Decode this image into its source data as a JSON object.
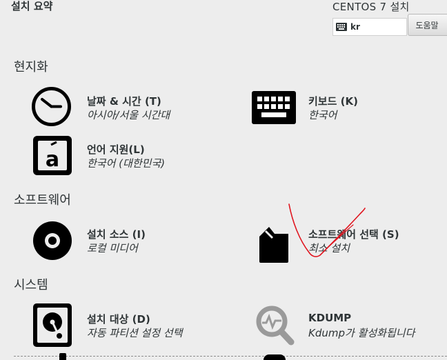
{
  "header": {
    "title": "설치 요약",
    "product": "CENTOS 7 설치",
    "keyboard_layout": "kr",
    "help_label": "도움말"
  },
  "sections": {
    "localization": "현지화",
    "software": "소프트웨어",
    "system": "시스템"
  },
  "spokes": {
    "datetime": {
      "title": "날짜 & 시간 (T)",
      "status": "아시아/서울 시간대"
    },
    "keyboard": {
      "title": "키보드 (K)",
      "status": "한국어"
    },
    "language": {
      "title": "언어 지원(L)",
      "status": "한국어 (대한민국)"
    },
    "source": {
      "title": "설치 소스 (I)",
      "status": "로컬 미디어"
    },
    "software": {
      "title": "소프트웨어 선택 (S)",
      "status": "최소 설치"
    },
    "destination": {
      "title": "설치 대상 (D)",
      "status": "자동 파티션 설정 선택"
    },
    "kdump": {
      "title": "KDUMP",
      "status": "Kdump가 활성화됩니다"
    }
  },
  "colors": {
    "background": "#ededed",
    "text": "#2e3436",
    "annotation": "#e0141e",
    "icon": "#000000",
    "icon_disabled": "#9a9a9a"
  },
  "icons": {
    "datetime": "clock-icon",
    "keyboard": "keyboard-icon",
    "language": "language-icon",
    "source": "disc-icon",
    "software": "package-icon",
    "destination": "harddisk-icon",
    "kdump": "kdump-icon",
    "kb_indicator": "keyboard-indicator-icon"
  }
}
